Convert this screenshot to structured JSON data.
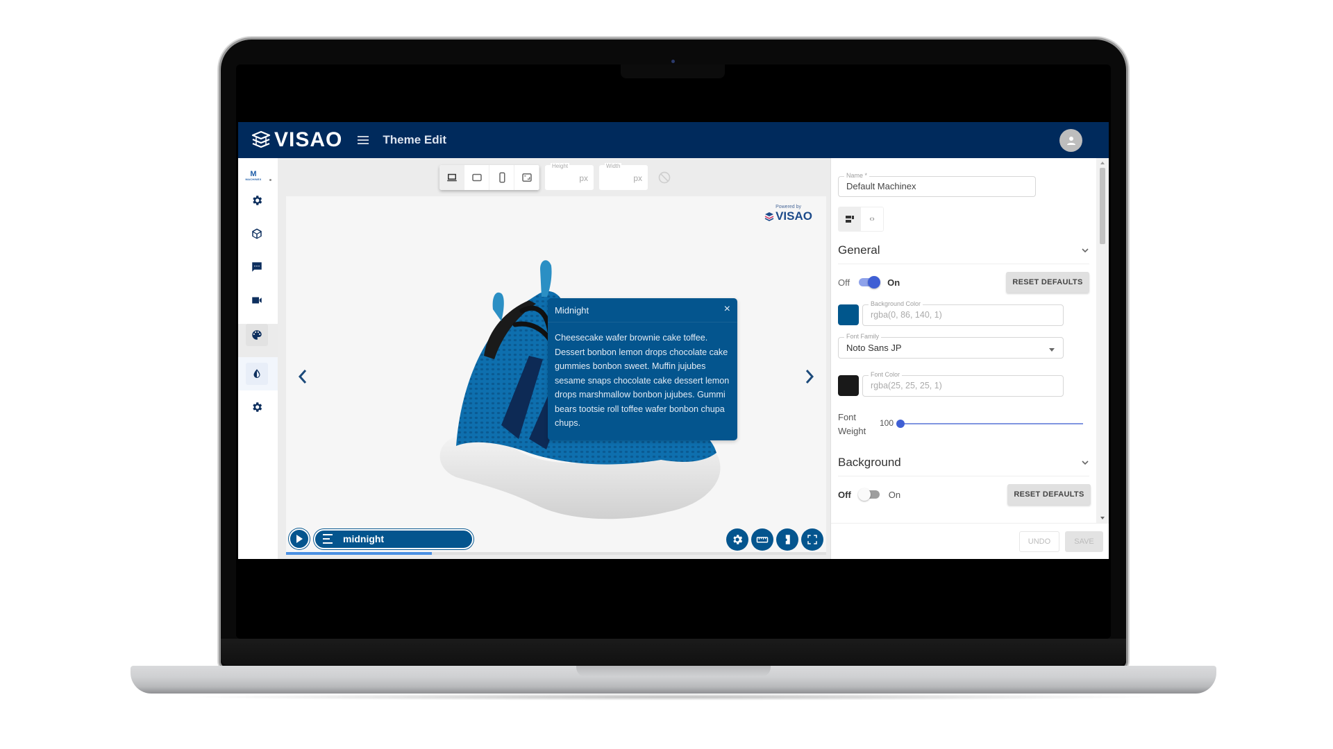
{
  "app": {
    "brand": "VISAO",
    "page_title": "Theme Edit",
    "org_logo": {
      "letter": "M",
      "name": "MACHINEX"
    }
  },
  "sidebar": {
    "items": [
      {
        "id": "settings",
        "icon": "gear-icon"
      },
      {
        "id": "models",
        "icon": "cube-icon"
      },
      {
        "id": "hotspots",
        "icon": "chat-icon"
      },
      {
        "id": "videos",
        "icon": "video-camera-icon"
      },
      {
        "id": "presentation",
        "icon": "laptop-icon"
      },
      {
        "id": "themes",
        "icon": "palette-icon",
        "state": "active"
      },
      {
        "id": "contrast",
        "icon": "contrast-icon",
        "state": "hover"
      },
      {
        "id": "admin",
        "icon": "gear-icon"
      }
    ]
  },
  "toolbar": {
    "devices": [
      {
        "id": "desktop",
        "icon": "laptop-icon",
        "active": true
      },
      {
        "id": "tablet",
        "icon": "tablet-landscape-icon",
        "active": false
      },
      {
        "id": "mobile",
        "icon": "phone-icon",
        "active": false
      },
      {
        "id": "custom",
        "icon": "resize-icon",
        "active": false
      }
    ],
    "height": {
      "label": "Height",
      "value": "",
      "unit": "px"
    },
    "width": {
      "label": "Width",
      "value": "",
      "unit": "px"
    },
    "rotate_icon": "rotate-disabled-icon"
  },
  "preview": {
    "powered_by": "Powered by",
    "powered_brand": "VISAO",
    "hotspot": {
      "title": "Midnight",
      "close_glyph": "×",
      "body": "Cheesecake wafer brownie cake toffee. Dessert bonbon lemon drops chocolate cake gummies bonbon sweet. Muffin jujubes sesame snaps chocolate cake dessert lemon drops marshmallow bonbon jujubes. Gummi bears tootsie roll toffee wafer bonbon chupa chups."
    },
    "player": {
      "chapter": "midnight",
      "progress_percent": 27
    },
    "tools": [
      {
        "id": "settings",
        "icon": "gear-icon"
      },
      {
        "id": "measure",
        "icon": "ruler-icon"
      },
      {
        "id": "explode",
        "icon": "puzzle-icon"
      },
      {
        "id": "fullscreen",
        "icon": "fullscreen-icon"
      }
    ],
    "colors": {
      "primary": "#04558e",
      "canvas": "#f6f6f6"
    }
  },
  "panel": {
    "name": {
      "label": "Name *",
      "value": "Default Machinex"
    },
    "modes": [
      {
        "id": "visual",
        "icon": "form-icon",
        "active": true
      },
      {
        "id": "code",
        "icon": "code-icon",
        "active": false,
        "glyph": "‹›"
      }
    ],
    "general": {
      "title": "General",
      "off_label": "Off",
      "on_label": "On",
      "enabled": true,
      "reset_label": "RESET DEFAULTS",
      "background_color": {
        "label": "Background Color",
        "value": "rgba(0, 86, 140, 1)",
        "swatch": "#00568c"
      },
      "font_family": {
        "label": "Font Family",
        "value": "Noto Sans JP"
      },
      "font_color": {
        "label": "Font Color",
        "value": "rgba(25, 25, 25, 1)",
        "swatch": "#191919"
      },
      "font_weight": {
        "label": "Font Weight",
        "value": "100",
        "min": 100,
        "max": 900
      }
    },
    "background": {
      "title": "Background",
      "off_label": "Off",
      "on_label": "On",
      "enabled": false,
      "reset_label": "RESET DEFAULTS"
    },
    "actions": {
      "undo_label": "UNDO",
      "save_label": "SAVE"
    }
  },
  "colors": {
    "header": "#002a5c",
    "accent": "#3f5fd4",
    "nav_icon": "#0d2f5e"
  }
}
